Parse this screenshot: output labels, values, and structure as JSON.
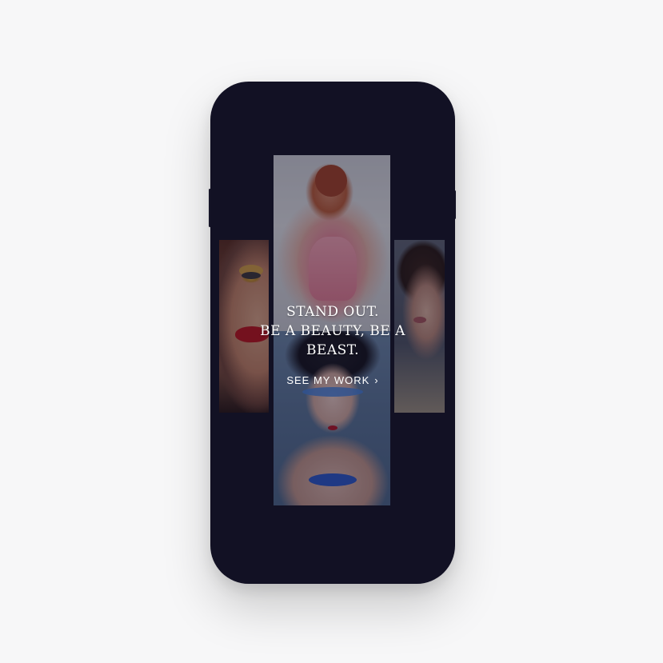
{
  "hero": {
    "lines": [
      "STAND OUT.",
      "BE A BEAUTY, BE A",
      "BEAST."
    ]
  },
  "cta": {
    "label": "SEE MY WORK",
    "icon": "chevron-right-icon"
  },
  "colors": {
    "page_bg": "#f7f7f8",
    "phone_bg": "#121124",
    "text": "#ffffff"
  }
}
